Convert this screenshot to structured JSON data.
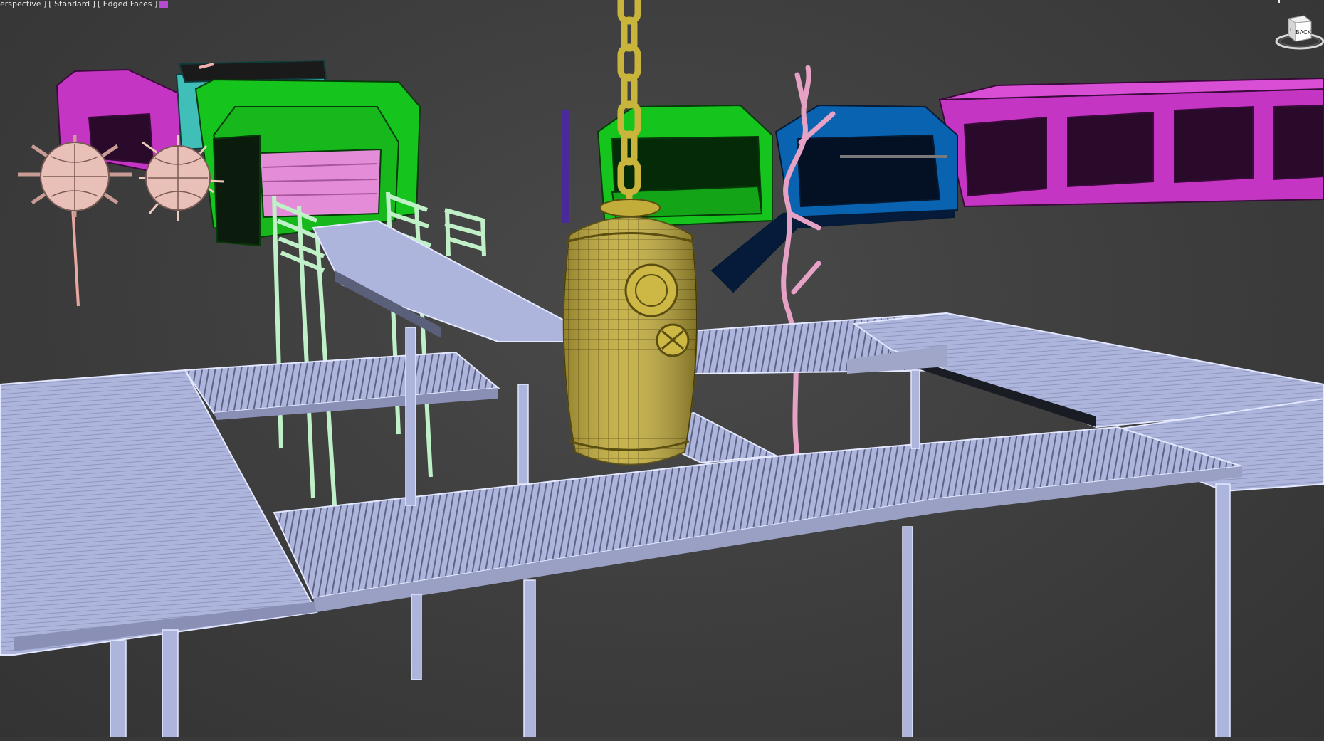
{
  "viewport": {
    "label": {
      "view": "erspective",
      "shading": "Standard",
      "edges": "Edged Faces"
    },
    "colors": {
      "background": "#3f3f3f",
      "walkway": "#aeb5dc",
      "walkway_edge": "#e4e8ff",
      "bell": "#c2ac3a",
      "chain": "#c9b53b",
      "green": "#15c41c",
      "magenta": "#c535c3",
      "blue": "#0a63b0",
      "teal": "#3fbfb8",
      "mine": "#e8c0b8",
      "coral": "#e6a2c4",
      "railing": "#bff0c8",
      "label_swatch": "#b44bd0"
    }
  },
  "viewcube": {
    "face": "BACK",
    "side": "L"
  }
}
